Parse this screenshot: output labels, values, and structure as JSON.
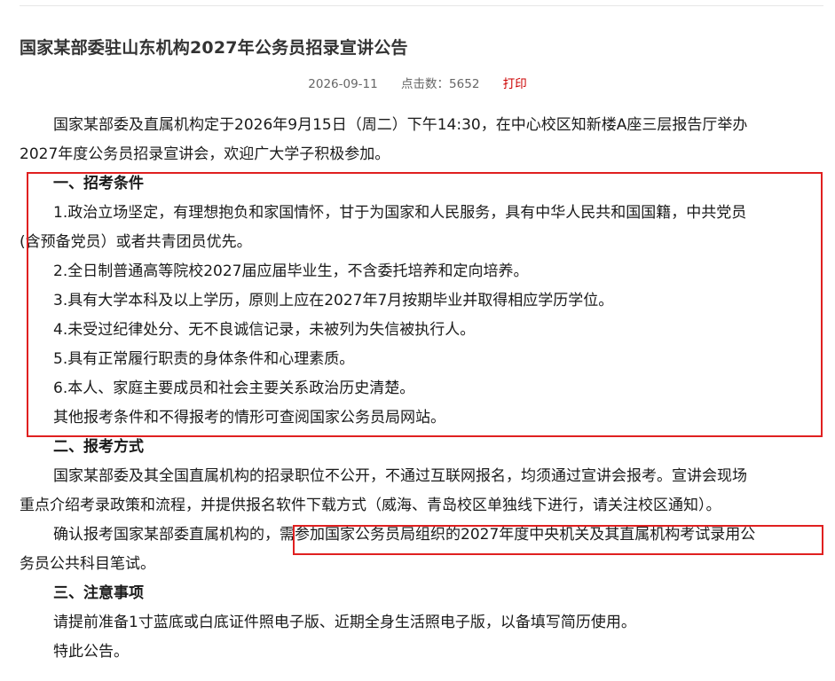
{
  "article": {
    "title": "国家某部委驻山东机构2027年公务员招录宣讲公告",
    "date": "2026-09-11",
    "hits_label": "点击数：",
    "hits_value": "5652",
    "print_label": "打印"
  },
  "intro": {
    "line1": "国家某部委及直属机构定于2026年9月15日（周二）下午14:30，在中心校区知新楼A座三层报告厅举办",
    "line2": "2027年度公务员招录宣讲会，欢迎广大学子积极参加。"
  },
  "section1": {
    "heading": "一、招考条件",
    "item1_line1": "1.政治立场坚定，有理想抱负和家国情怀，甘于为国家和人民服务，具有中华人民共和国国籍，中共党员",
    "item1_line2": "(含预备党员）或者共青团员优先。",
    "item2": "2.全日制普通高等院校2027届应届毕业生，不含委托培养和定向培养。",
    "item3": "3.具有大学本科及以上学历，原则上应在2027年7月按期毕业并取得相应学历学位。",
    "item4": "4.未受过纪律处分、无不良诚信记录，未被列为失信被执行人。",
    "item5": "5.具有正常履行职责的身体条件和心理素质。",
    "item6": "6.本人、家庭主要成员和社会主要关系政治历史清楚。",
    "note": "其他报考条件和不得报考的情形可查阅国家公务员局网站。"
  },
  "section2": {
    "heading": "二、报考方式",
    "p1_line1": "国家某部委及其全国直属机构的招录职位不公开，不通过互联网报名，均须通过宣讲会报考。宣讲会现场",
    "p1_line2": "重点介绍考录政策和流程，并提供报名软件下载方式（威海、青岛校区单独线下进行，请关注校区通知）。",
    "p2_line1a": "确认报考国家某部委直属机构的，",
    "p2_line1b": "需参加国家公务员局组织的2027年度中央机关及其直属机构考试录用公",
    "p2_line2": "务员公共科目笔试。"
  },
  "section3": {
    "heading": "三、注意事项",
    "p1": "请提前准备1寸蓝底或白底证件照电子版、近期全身生活照电子版，以备填写简历使用。",
    "p2": "特此公告。"
  },
  "colors": {
    "annotation_red": "#e02020",
    "print_link": "#cc0000"
  }
}
